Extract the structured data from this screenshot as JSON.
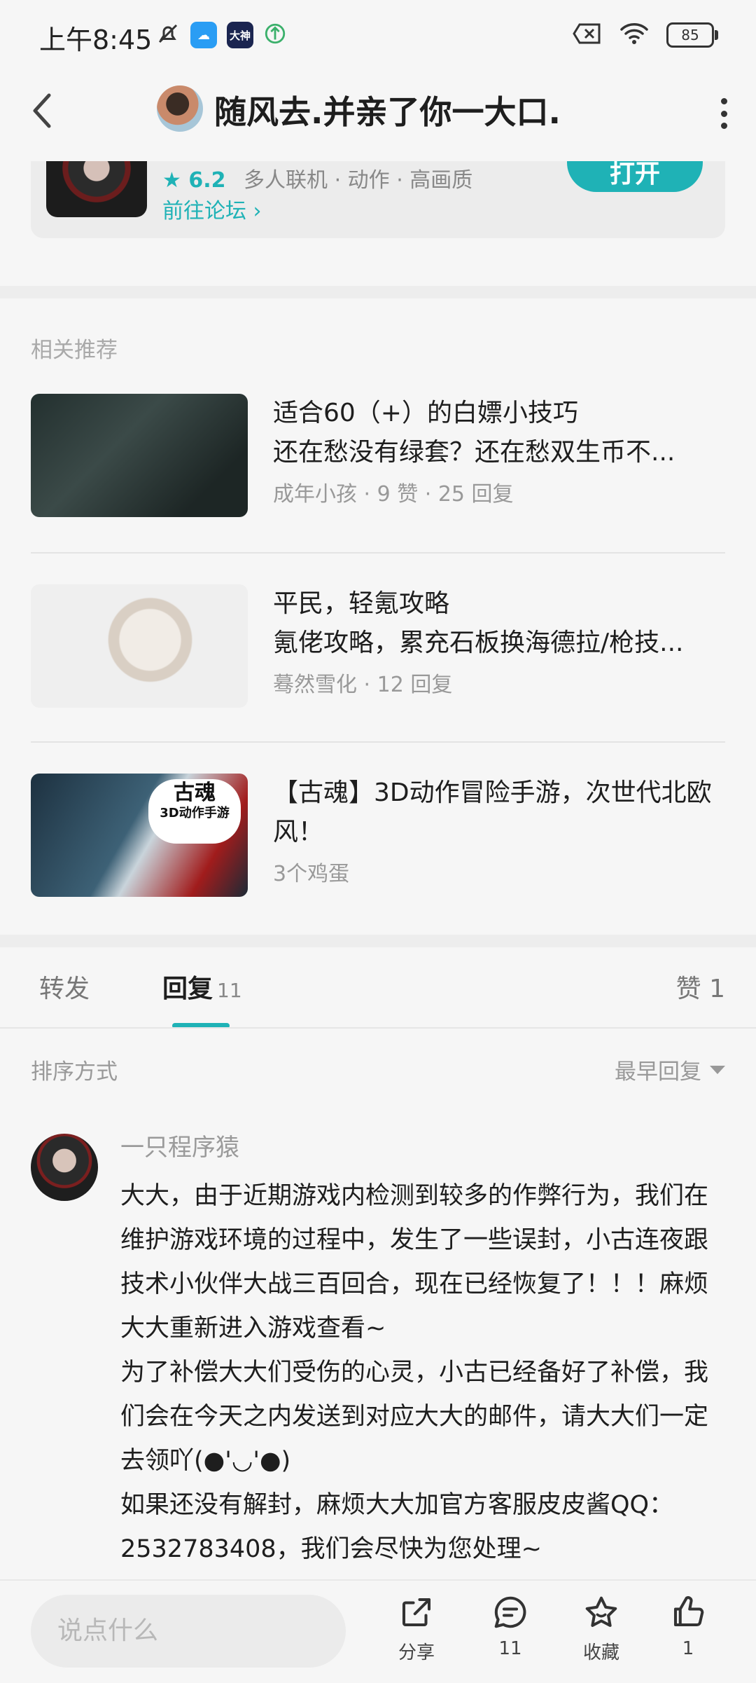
{
  "status_bar": {
    "time": "上午8:45",
    "battery": "85",
    "app_badge": "大神"
  },
  "header": {
    "title": "随风去.并亲了你一大口."
  },
  "game_card": {
    "rating": "6.2",
    "tags": "多人联机 · 动作 · 高画质",
    "forum_link": "前往论坛",
    "open_label": "打开"
  },
  "related": {
    "title": "相关推荐",
    "items": [
      {
        "title": "适合60（+）的白嫖小技巧",
        "subtitle": "还在愁没有绿套？还在愁双生币不...",
        "meta": "成年小孩 · 9 赞 · 25 回复"
      },
      {
        "title": "平民，轻氪攻略",
        "subtitle": "氪佬攻略，累充石板换海德拉/枪技...",
        "meta": "蓦然雪化 · 12 回复"
      },
      {
        "title": "【古魂】3D动作冒险手游，次世代北欧风！",
        "subtitle": "",
        "meta": "3个鸡蛋",
        "badge_main": "古魂",
        "badge_sub": "3D动作手游"
      }
    ]
  },
  "tabs": {
    "forward": "转发",
    "reply": "回复",
    "reply_count": "11",
    "like": "赞 1"
  },
  "sort": {
    "label": "排序方式",
    "value": "最早回复"
  },
  "comment": {
    "author": "一只程序猿",
    "paragraphs": [
      "大大，由于近期游戏内检测到较多的作弊行为，我们在维护游戏环境的过程中，发生了一些误封，小古连夜跟技术小伙伴大战三百回合，现在已经恢复了！！！麻烦大大重新进入游戏查看~",
      "为了补偿大大们受伤的心灵，小古已经备好了补偿，我们会在今天之内发送到对应大大的邮件，请大大们一定去领吖(●'◡'●)",
      "如果还没有解封，麻烦大大加官方客服皮皮酱QQ：2532783408，我们会尽快为您处理~"
    ]
  },
  "bottom_bar": {
    "input_placeholder": "说点什么",
    "share": "分享",
    "comments": "11",
    "favorite": "收藏",
    "likes": "1"
  },
  "colors": {
    "accent": "#1fb2b6",
    "text": "#1e1e1e",
    "muted": "#999999"
  }
}
